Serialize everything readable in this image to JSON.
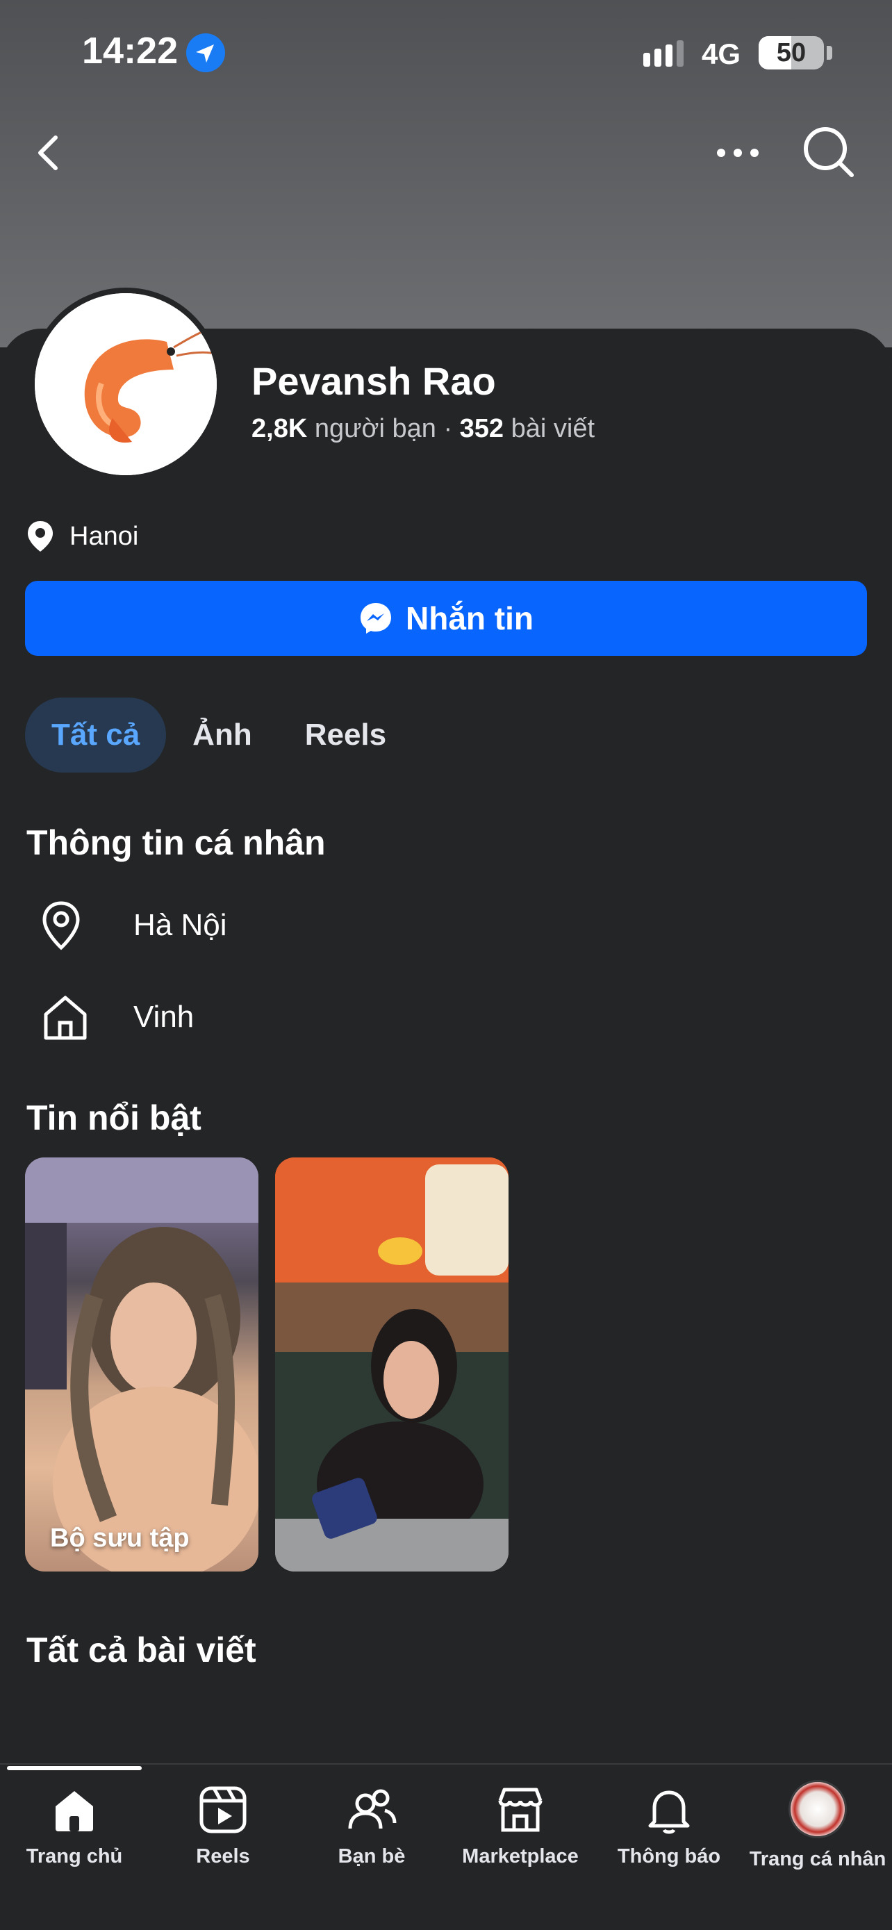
{
  "status_bar": {
    "time": "14:22",
    "network": "4G",
    "battery": "50",
    "battery_level": 0.5
  },
  "header": {
    "back_icon": "chevron-left-icon",
    "more_icon": "more-horizontal-icon",
    "search_icon": "search-icon"
  },
  "profile": {
    "name": "Pevansh Rao",
    "friends_count": "2,8K",
    "friends_label": "người bạn",
    "separator": "·",
    "posts_count": "352",
    "posts_label": "bài viết",
    "location": "Hanoi",
    "avatar_icon": "shrimp-avatar"
  },
  "message_button": {
    "label": "Nhắn tin",
    "icon": "messenger-icon",
    "color": "#0866ff"
  },
  "tabs": [
    {
      "label": "Tất cả",
      "active": true
    },
    {
      "label": "Ảnh",
      "active": false
    },
    {
      "label": "Reels",
      "active": false
    }
  ],
  "personal_info": {
    "title": "Thông tin cá nhân",
    "items": [
      {
        "icon": "location-pin-icon",
        "text": "Hà Nội"
      },
      {
        "icon": "home-icon",
        "text": "Vinh"
      }
    ]
  },
  "highlights": {
    "title": "Tin nổi bật",
    "items": [
      {
        "label": "Bộ sưu tập"
      },
      {
        "label": ""
      }
    ]
  },
  "all_posts": {
    "title": "Tất cả bài viết"
  },
  "bottom_nav": {
    "items": [
      {
        "label": "Trang chủ",
        "icon": "home-icon",
        "active": true
      },
      {
        "label": "Reels",
        "icon": "reels-icon",
        "active": false
      },
      {
        "label": "Bạn bè",
        "icon": "friends-icon",
        "active": false
      },
      {
        "label": "Marketplace",
        "icon": "marketplace-icon",
        "active": false
      },
      {
        "label": "Thông báo",
        "icon": "bell-icon",
        "active": false
      },
      {
        "label": "Trang cá nhân",
        "icon": "profile-avatar-icon",
        "active": false
      }
    ]
  },
  "colors": {
    "background": "#242527",
    "accent": "#0866ff",
    "active_tab_bg": "#263951",
    "active_tab_text": "#5aa7ff"
  }
}
